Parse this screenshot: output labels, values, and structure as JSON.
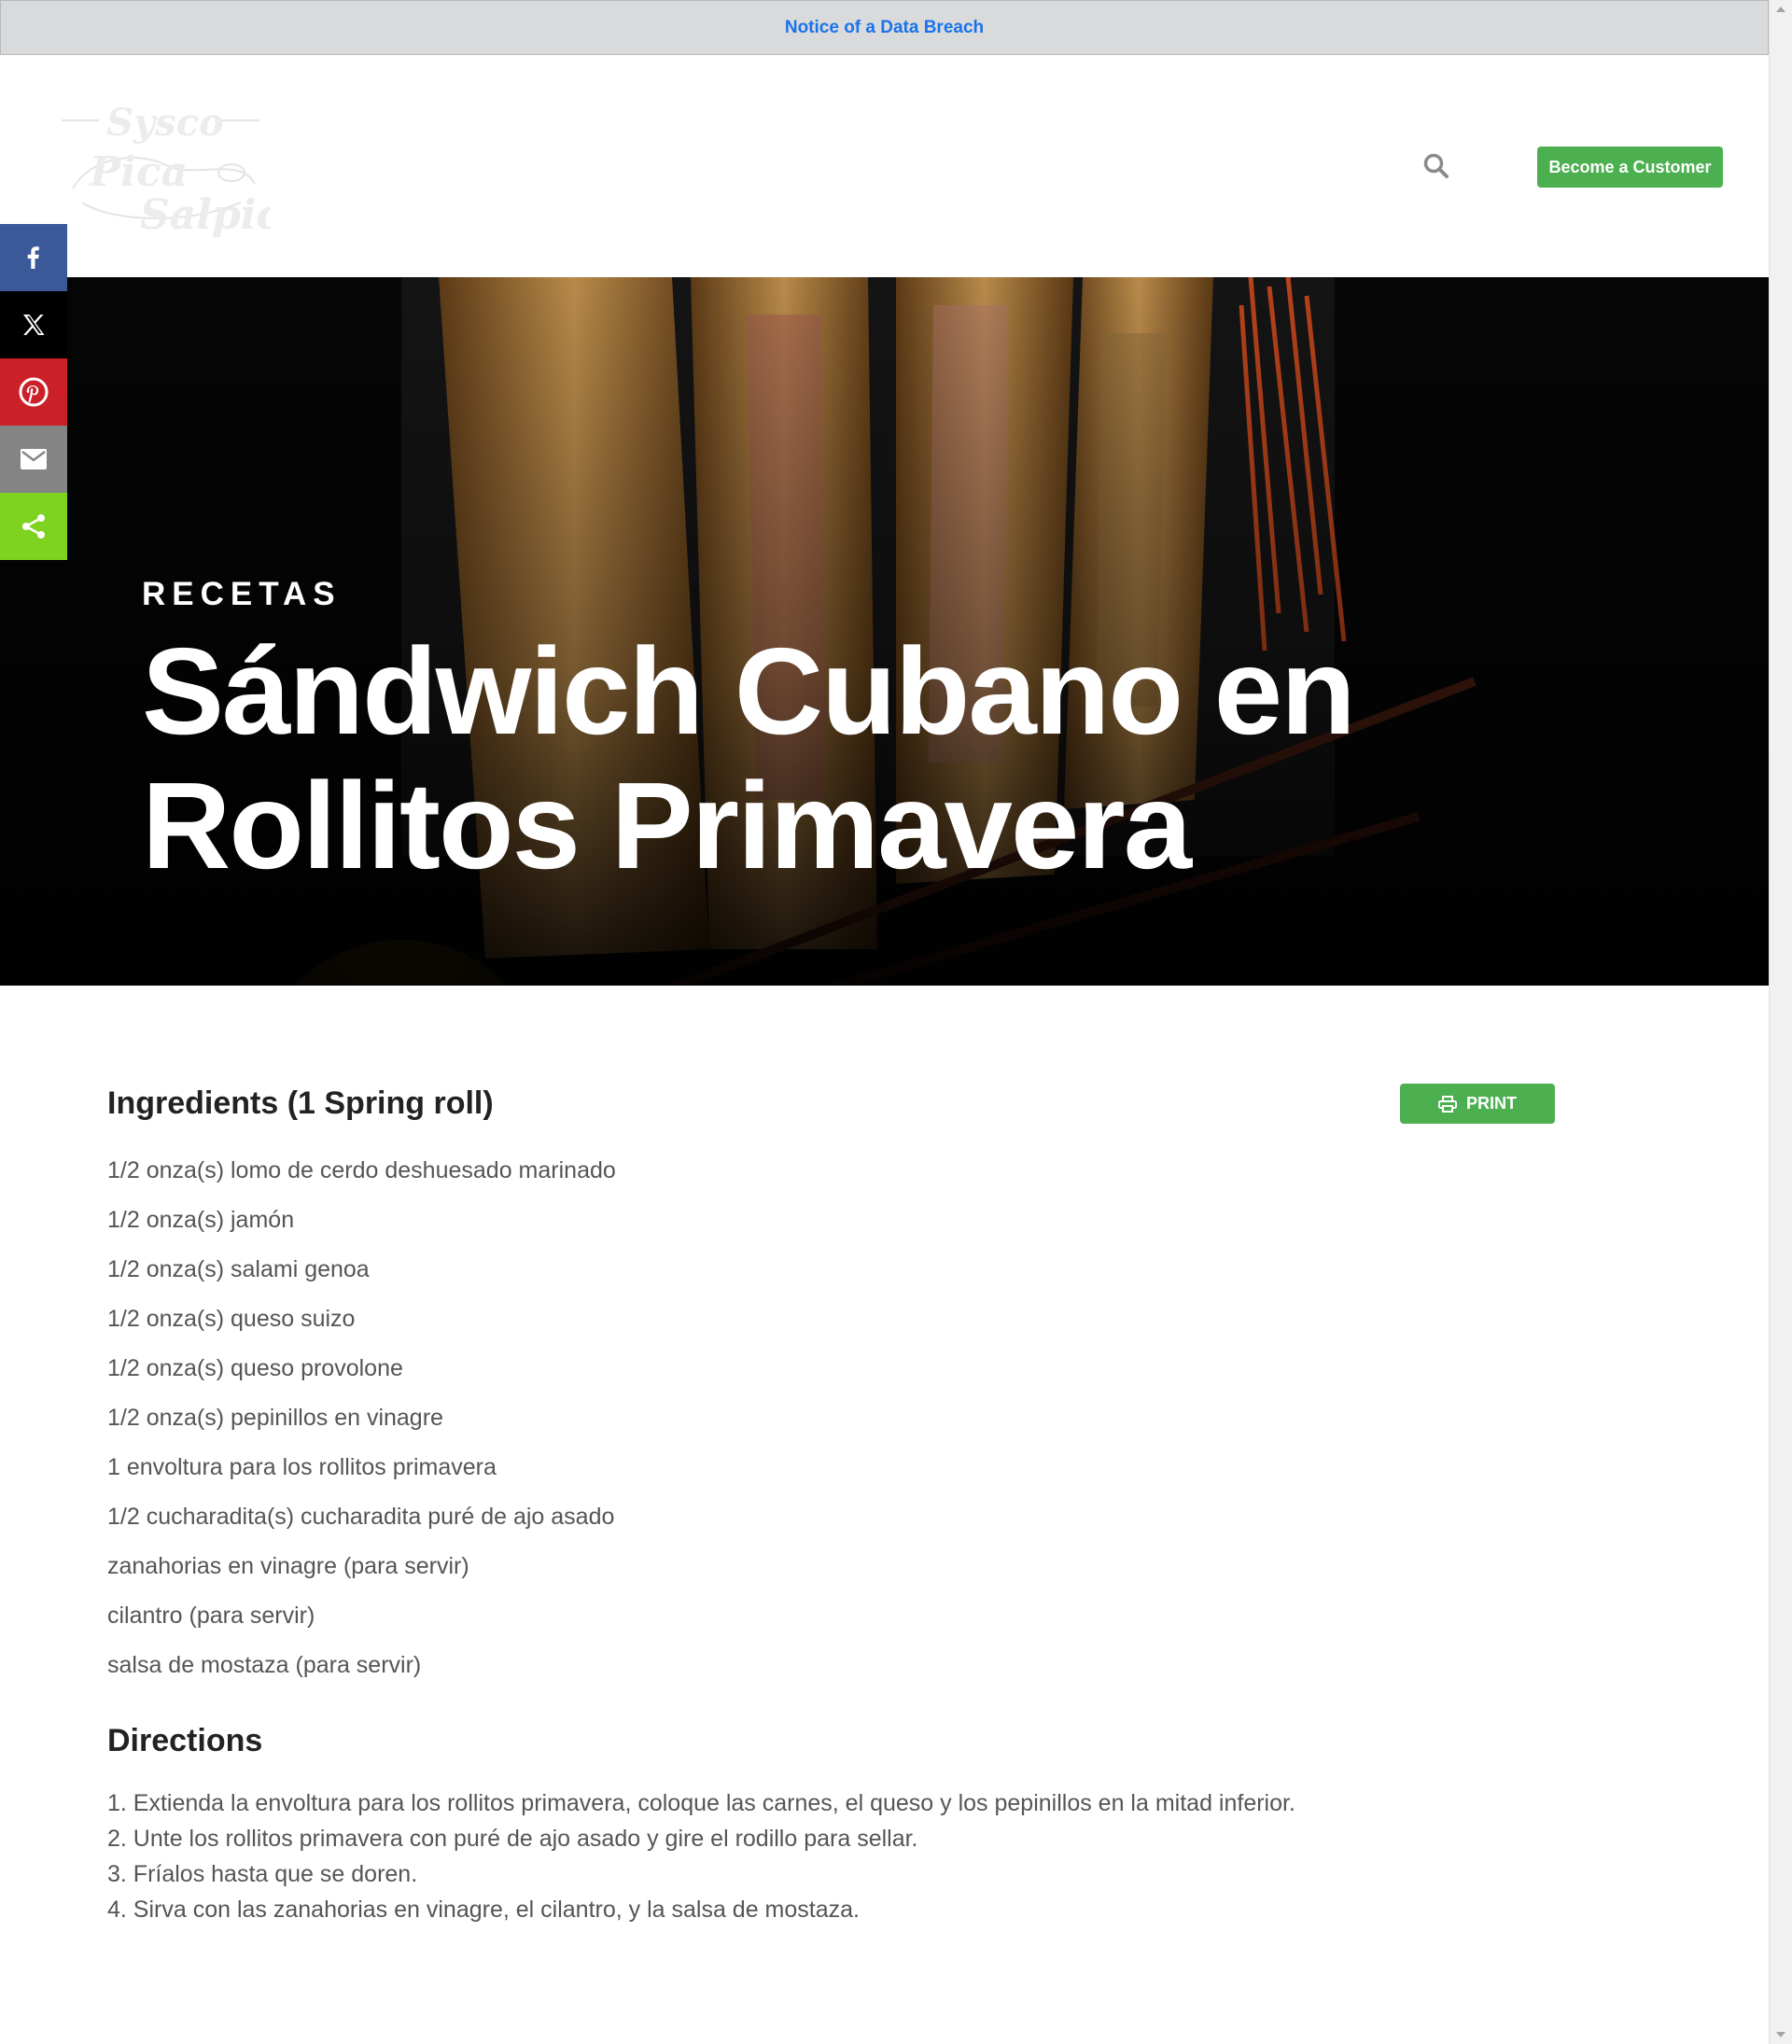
{
  "notice": {
    "label": "Notice of a Data Breach"
  },
  "header": {
    "logo_text": {
      "top": "Sysco",
      "middle": "Pica",
      "bottom": "Salpica"
    },
    "cta_label": "Become a Customer"
  },
  "share_bar": [
    {
      "name": "facebook",
      "icon": "facebook-icon",
      "color": "#3b5998"
    },
    {
      "name": "twitter-x",
      "icon": "x-icon",
      "color": "#000000"
    },
    {
      "name": "pinterest",
      "icon": "pinterest-icon",
      "color": "#cb2027"
    },
    {
      "name": "email",
      "icon": "email-icon",
      "color": "#848484"
    },
    {
      "name": "share",
      "icon": "share-icon",
      "color": "#7ed321"
    }
  ],
  "hero": {
    "category": "RECETAS",
    "title_line1": "Sándwich Cubano en",
    "title_line2": "Rollitos Primavera"
  },
  "recipe": {
    "ingredients_heading": "Ingredients (1 Spring roll)",
    "print_label": "PRINT",
    "ingredients": [
      "1/2 onza(s) lomo de cerdo deshuesado marinado",
      "1/2 onza(s) jamón",
      "1/2 onza(s) salami genoa",
      "1/2 onza(s) queso suizo",
      "1/2 onza(s) queso provolone",
      "1/2 onza(s) pepinillos en vinagre",
      "1 envoltura para los rollitos primavera",
      "1/2 cucharadita(s) cucharadita puré de ajo asado",
      "zanahorias en vinagre (para servir)",
      "cilantro (para servir)",
      "salsa de mostaza (para servir)"
    ],
    "directions_heading": "Directions",
    "directions": [
      "1. Extienda la envoltura para los rollitos primavera, coloque las carnes, el queso y los pepinillos en la mitad inferior.",
      "2. Unte los rollitos primavera con puré de ajo asado y gire el rodillo para sellar.",
      "3. Fríalos hasta que se doren.",
      "4. Sirva con las zanahorias en vinagre, el cilantro, y la salsa de mostaza."
    ]
  },
  "colors": {
    "accent_green": "#4cb050",
    "notice_link": "#1a73e8",
    "notice_bg": "#d9dadc"
  }
}
